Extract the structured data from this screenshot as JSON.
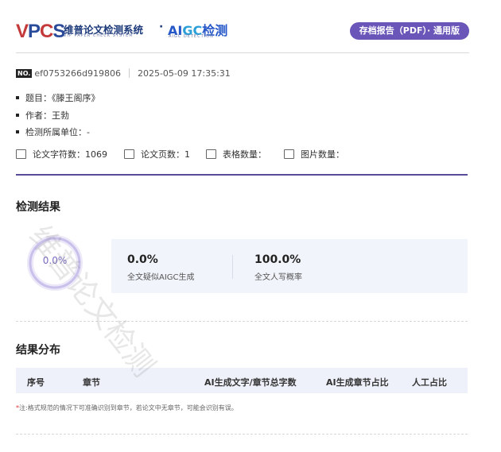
{
  "header": {
    "logo_text": "VPCS",
    "system_name": "维普论文检测系统",
    "system_name_en": "VIP PAPER CHECK SYSTEM",
    "separator": "·",
    "aigc_logo": "AIGC检测",
    "aigc_logo_en": "AIGC DETECTION",
    "badge": "存档报告（PDF）· 通用版"
  },
  "meta": {
    "no_label": "NO.",
    "report_id": "ef0753266d919806",
    "datetime": "2025-05-09 17:35:31"
  },
  "info": {
    "title_label": "题目：",
    "title_value": "《滕王阁序》",
    "author_label": "作者：",
    "author_value": "王勃",
    "unit_label": "检测所属单位：",
    "unit_value": "-"
  },
  "stats": {
    "char_count_label": "论文字符数：",
    "char_count": "1069",
    "page_count_label": "论文页数：",
    "page_count": "1",
    "table_count_label": "表格数量：",
    "table_count": "",
    "image_count_label": "图片数量：",
    "image_count": ""
  },
  "results": {
    "section_title": "检测结果",
    "ring_value": "0.0%",
    "ring_fraction": 0,
    "aigc_value": "0.0%",
    "aigc_label": "全文疑似AIGC生成",
    "human_value": "100.0%",
    "human_label": "全文人写概率"
  },
  "distribution": {
    "section_title": "结果分布",
    "columns": [
      "序号",
      "章节",
      "AI生成文字/章节总字数",
      "AI生成章节占比",
      "人工占比"
    ],
    "note_star": "*",
    "note": "注:格式规范的情况下可准确识别到章节，若论文中无章节，可能会识别有误。"
  },
  "watermark": "维普论文检测",
  "colors": {
    "accent_purple": "#6a55b8",
    "ring_purple": "#9a8ad8",
    "result_bg": "#f1f4fa",
    "brand_red": "#c43a3a",
    "brand_blue": "#2a4a9a"
  }
}
